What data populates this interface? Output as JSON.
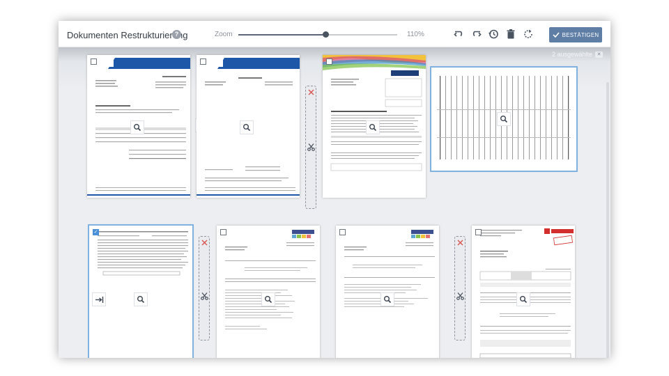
{
  "toolbar": {
    "title": "Dokumenten Restrukturierung",
    "help_icon": "?",
    "zoom_label": "Zoom",
    "zoom_percent": 110,
    "zoom_min": 0,
    "zoom_max": 200,
    "zoom_value_text": "110%",
    "tools": [
      {
        "name": "undo-icon"
      },
      {
        "name": "redo-icon"
      },
      {
        "name": "history-icon"
      },
      {
        "name": "trash-icon"
      },
      {
        "name": "rotate-icon"
      }
    ],
    "confirm_label": "BESTÄTIGEN"
  },
  "selection": {
    "count_text": "2 ausgewählte",
    "clear_icon": "✕"
  },
  "colors": {
    "accent": "#5e7ea6",
    "selected_outline": "#7fb2e0",
    "split_icon": "#d9534f"
  },
  "pages": [
    {
      "id": 1,
      "checked": false,
      "logo": "brix Zaun",
      "heading": "RECHNUNG"
    },
    {
      "id": 2,
      "checked": false,
      "logo": "brix Zaun",
      "heading": "RECHNUNG"
    },
    {
      "id": 3,
      "checked": false,
      "logo": "DIALOG",
      "heading": "Ihre DIALOG-Rechnung für August 2021"
    },
    {
      "id": 4,
      "checked": true
    },
    {
      "id": 5,
      "checked": true
    },
    {
      "id": 6,
      "checked": false,
      "logo": "LAKAL"
    },
    {
      "id": 7,
      "checked": false,
      "logo": "LAKAL"
    },
    {
      "id": 8,
      "checked": false,
      "logo": "BERNER",
      "heading": "RECHNUNG"
    }
  ]
}
